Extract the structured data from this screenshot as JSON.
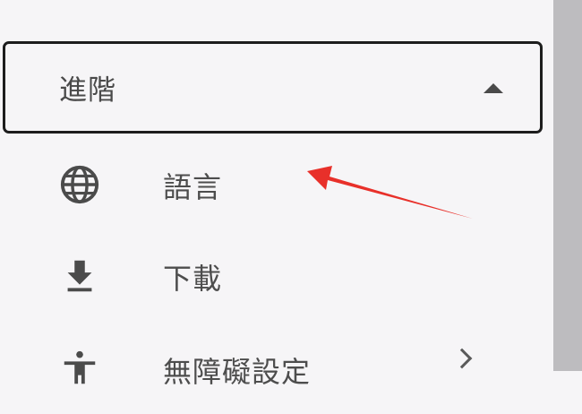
{
  "menu": {
    "section_header": {
      "label": "進階",
      "expanded": true
    },
    "items": [
      {
        "label": "語言",
        "icon": "globe-icon"
      },
      {
        "label": "下載",
        "icon": "download-icon"
      },
      {
        "label": "無障礙設定",
        "icon": "accessibility-icon"
      }
    ]
  },
  "colors": {
    "background": "#f6f5f7",
    "border": "#1d1d1d",
    "text": "#4a4a4a",
    "icon": "#4b4b4b",
    "scroll_track": "#bdbcbf",
    "arrow": "#e8302a"
  }
}
